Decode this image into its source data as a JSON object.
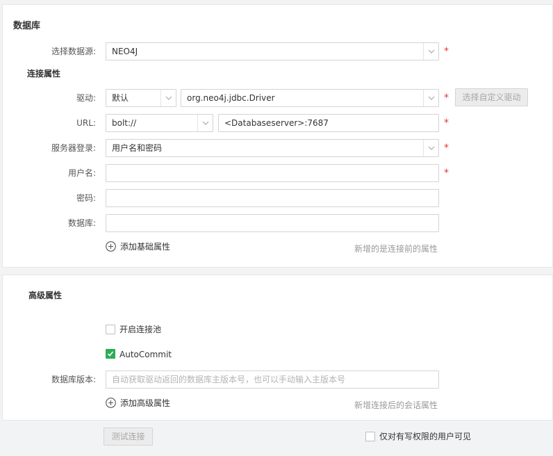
{
  "database_section": {
    "title": "数据库",
    "datasource_label": "选择数据源:",
    "datasource_value": "NEO4J",
    "connection_title": "连接属性",
    "driver_label": "驱动:",
    "driver_mode": "默认",
    "driver_class": "org.neo4j.jdbc.Driver",
    "custom_driver_button": "选择自定义驱动",
    "url_label": "URL:",
    "url_protocol": "bolt://",
    "url_host": "<Databaseserver>:7687",
    "auth_label": "服务器登录:",
    "auth_value": "用户名和密码",
    "username_label": "用户名:",
    "username_value": "",
    "password_label": "密码:",
    "password_value": "",
    "database_label": "数据库:",
    "database_value": "",
    "add_basic_property": "添加基础属性",
    "basic_property_hint": "新增的是连接前的属性",
    "required_mark": "*"
  },
  "advanced_section": {
    "title": "高级属性",
    "connection_pool_label": "开启连接池",
    "connection_pool_checked": false,
    "autocommit_label": "AutoCommit",
    "autocommit_checked": true,
    "db_version_label": "数据库版本:",
    "db_version_placeholder": "自动获取驱动返回的数据库主版本号，也可以手动输入主版本号",
    "add_advanced_property": "添加高级属性",
    "advanced_property_hint": "新增连接后的会话属性"
  },
  "footer": {
    "test_connection_button": "测试连接",
    "visibility_label": "仅对有写权限的用户可见",
    "visibility_checked": false
  },
  "colors": {
    "required": "#e0393e",
    "checkbox_checked": "#2cae56",
    "border": "#d4d4d4"
  }
}
